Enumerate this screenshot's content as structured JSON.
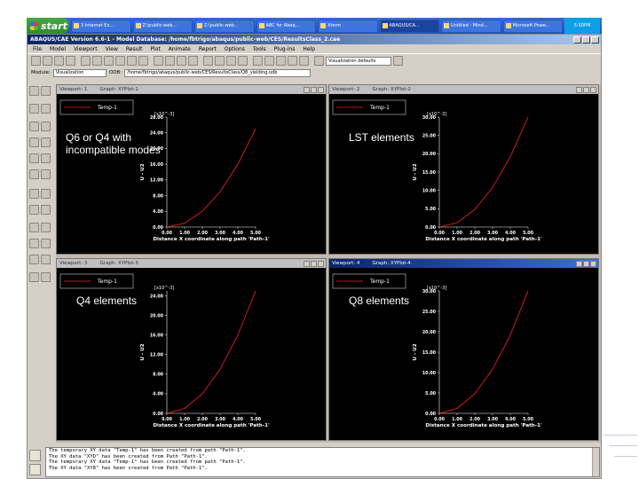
{
  "taskbar": {
    "start_label": "start",
    "tasks": [
      {
        "label": "3 Internet Ex..."
      },
      {
        "label": "Z:\\public-web..."
      },
      {
        "label": "Z:\\public-web..."
      },
      {
        "label": "ABC for Abaq..."
      },
      {
        "label": "Xterm"
      },
      {
        "label": "ABAQUS/CA..."
      },
      {
        "label": "Untitled - Mind..."
      },
      {
        "label": "Microsoft Powe..."
      }
    ],
    "tray_time": "5:50PM"
  },
  "app": {
    "title": "ABAQUS/CAE Version 6.6-1 - Model Database: /home/fbtrigo/abaqus/public-web/CES/ResultsClass_2.cae",
    "menu": [
      "File",
      "Model",
      "Viewport",
      "View",
      "Result",
      "Plot",
      "Animate",
      "Report",
      "Options",
      "Tools",
      "Plug-ins",
      "Help"
    ],
    "toolbar_select": "Visualization defaults",
    "context": {
      "module_label": "Module:",
      "module_value": "Visualization",
      "odb_label": "ODB:",
      "odb_path": "/home/fbtrigo/abaqus/public-web/CES/ResultsClass/Q8_yielding.odb"
    }
  },
  "viewports": [
    {
      "title": "Viewport: 1",
      "graph": "Graph: XYPlot-1",
      "annotation": "Q6 or Q4 with\nincompatible modes",
      "legend": "Temp-1",
      "active": false
    },
    {
      "title": "Viewport: 2",
      "graph": "Graph: XYPlot-2",
      "annotation": "LST elements",
      "legend": "Temp-1",
      "active": false
    },
    {
      "title": "Viewport: 3",
      "graph": "Graph: XYPlot-3",
      "annotation": "Q4 elements",
      "legend": "Temp-1",
      "active": false
    },
    {
      "title": "Viewport: 4",
      "graph": "Graph: XYPlot-4",
      "annotation": "Q8 elements",
      "legend": "Temp-1",
      "active": true
    }
  ],
  "chart_data": [
    {
      "type": "line",
      "series": [
        {
          "name": "Temp-1",
          "x": [
            0,
            1,
            2,
            3,
            4,
            5
          ],
          "y": [
            0,
            1.0,
            4.0,
            9.0,
            16.0,
            25.0
          ]
        }
      ],
      "xlabel": "Distance X coordinate along path 'Path-1'",
      "ylabel": "U - U2",
      "y_unit": "[x10^-3]",
      "x_ticks": [
        "0.00",
        "1.00",
        "2.00",
        "3.00",
        "4.00",
        "5.00"
      ],
      "y_ticks": [
        "0.00",
        "4.00",
        "8.00",
        "12.00",
        "16.00",
        "20.00",
        "24.00",
        "28.00"
      ],
      "xlim": [
        0,
        5
      ],
      "ylim": [
        0,
        28
      ],
      "color": "#ff2020"
    },
    {
      "type": "line",
      "series": [
        {
          "name": "Temp-1",
          "x": [
            0,
            1,
            2,
            3,
            4,
            5
          ],
          "y": [
            0,
            1.2,
            4.8,
            10.8,
            19.2,
            30.0
          ]
        }
      ],
      "xlabel": "Distance X coordinate along path 'Path-1'",
      "ylabel": "U - U2",
      "y_unit": "[x10^-3]",
      "x_ticks": [
        "0.00",
        "1.00",
        "2.00",
        "3.00",
        "4.00",
        "5.00"
      ],
      "y_ticks": [
        "0.00",
        "5.00",
        "10.00",
        "15.00",
        "20.00",
        "25.00",
        "30.00"
      ],
      "xlim": [
        0,
        5
      ],
      "ylim": [
        0,
        30
      ],
      "color": "#ff2020"
    },
    {
      "type": "line",
      "series": [
        {
          "name": "Temp-1",
          "x": [
            0,
            1,
            2,
            3,
            4,
            5
          ],
          "y": [
            0,
            1.0,
            4.0,
            9.0,
            16.0,
            25.0
          ]
        }
      ],
      "xlabel": "Distance X coordinate along path 'Path-1'",
      "ylabel": "U - U2",
      "y_unit": "[x10^-3]",
      "x_ticks": [
        "0.00",
        "1.00",
        "2.00",
        "3.00",
        "4.00",
        "5.00"
      ],
      "y_ticks": [
        "0.00",
        "4.00",
        "8.00",
        "12.00",
        "16.00",
        "20.00",
        "24.00"
      ],
      "xlim": [
        0,
        5
      ],
      "ylim": [
        0,
        25
      ],
      "color": "#ff2020"
    },
    {
      "type": "line",
      "series": [
        {
          "name": "Temp-1",
          "x": [
            0,
            1,
            2,
            3,
            4,
            5
          ],
          "y": [
            0,
            1.2,
            4.8,
            10.8,
            19.2,
            30.0
          ]
        }
      ],
      "xlabel": "Distance X coordinate along path 'Path-1'",
      "ylabel": "U - U2",
      "y_unit": "[x10^-3]",
      "x_ticks": [
        "0.00",
        "1.00",
        "2.00",
        "3.00",
        "4.00",
        "5.00"
      ],
      "y_ticks": [
        "0.00",
        "5.00",
        "10.00",
        "15.00",
        "20.00",
        "25.00",
        "30.00"
      ],
      "xlim": [
        0,
        5
      ],
      "ylim": [
        0,
        30
      ],
      "color": "#ff2020"
    }
  ],
  "messages": [
    "The temporary XY data \"Temp-1\" has been created from path \"Path-1\".",
    "The XY data \"XYD\" has been created from Path \"Path-1\".",
    "The temporary XY data \"Temp-1\" has been created from path \"Path-1\".",
    "The XY data \"XY8\" has been created from Path \"Path-1\"."
  ]
}
